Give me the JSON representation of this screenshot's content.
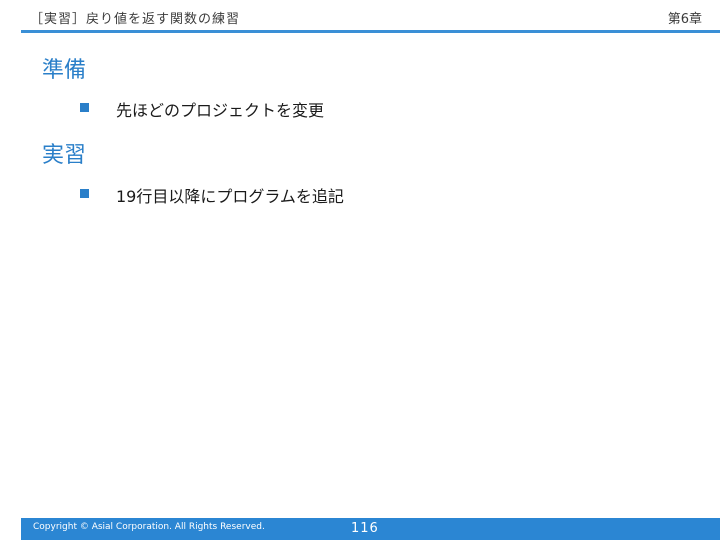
{
  "header": {
    "title": "［実習］戻り値を返す関数の練習",
    "chapter": "第6章"
  },
  "sections": [
    {
      "heading": "準備",
      "bullets": [
        "先ほどのプロジェクトを変更"
      ]
    },
    {
      "heading": "実習",
      "bullets": [
        "19行目以降にプログラムを追記"
      ]
    }
  ],
  "footer": {
    "copyright": "Copyright © Asial Corporation. All Rights Reserved.",
    "page_number": "116"
  },
  "colors": {
    "accent": "#2a7fc9",
    "rule": "#3a8fd6",
    "footer_bg": "#2b86d3"
  }
}
